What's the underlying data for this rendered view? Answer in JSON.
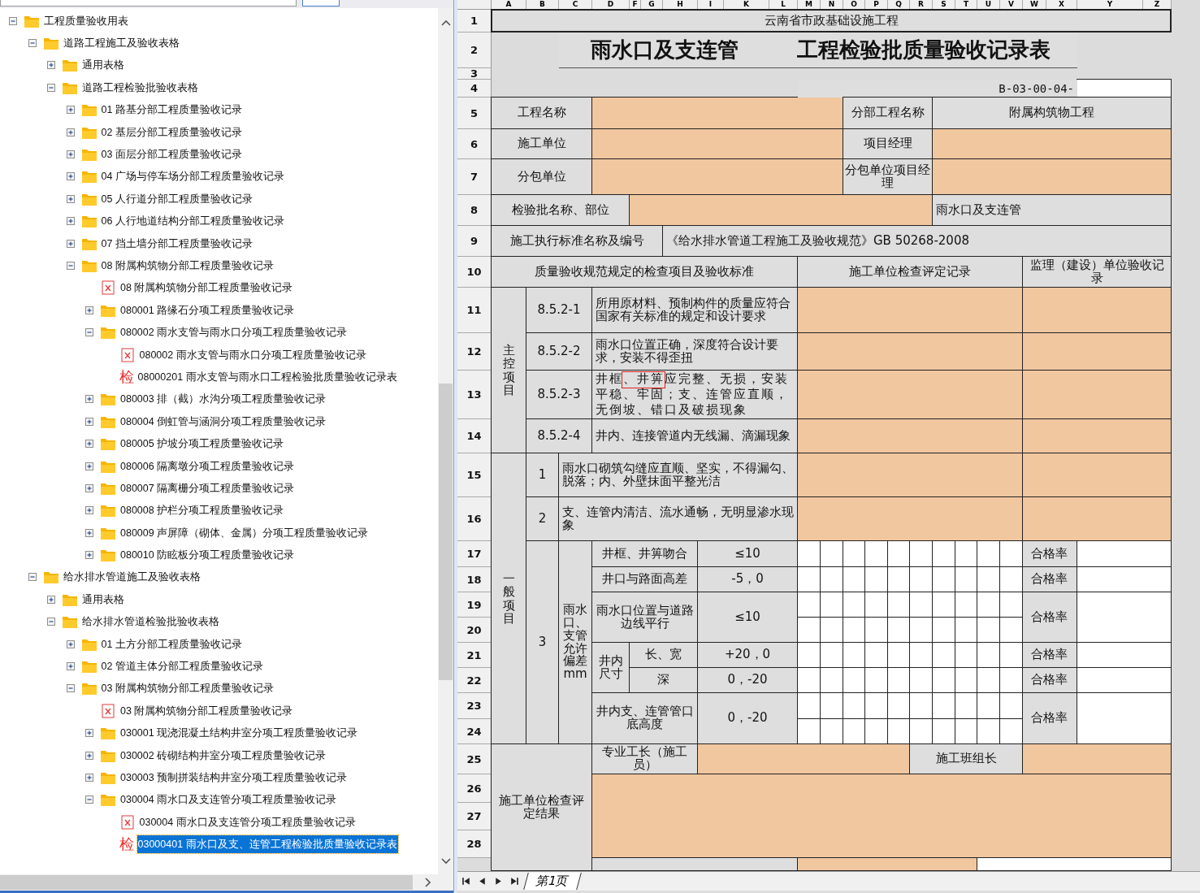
{
  "tree": {
    "items": [
      {
        "kind": "folder",
        "label": "工程质量验收用表",
        "expanded": true,
        "selected": false,
        "children": [
          {
            "kind": "folder",
            "label": "道路工程施工及验收表格",
            "expanded": true,
            "selected": false,
            "children": [
              {
                "kind": "folder",
                "label": "通用表格",
                "expanded": false,
                "selected": false
              },
              {
                "kind": "folder",
                "label": "道路工程检验批验收表格",
                "expanded": true,
                "selected": false,
                "children": [
                  {
                    "kind": "folder",
                    "label": "01 路基分部工程质量验收记录",
                    "expanded": false,
                    "selected": false
                  },
                  {
                    "kind": "folder",
                    "label": "02 基层分部工程质量验收记录",
                    "expanded": false,
                    "selected": false
                  },
                  {
                    "kind": "folder",
                    "label": "03 面层分部工程质量验收记录",
                    "expanded": false,
                    "selected": false
                  },
                  {
                    "kind": "folder",
                    "label": "04 广场与停车场分部工程质量验收记录",
                    "expanded": false,
                    "selected": false
                  },
                  {
                    "kind": "folder",
                    "label": "05 人行道分部工程质量验收记录",
                    "expanded": false,
                    "selected": false
                  },
                  {
                    "kind": "folder",
                    "label": "06 人行地道结构分部工程质量验收记录",
                    "expanded": false,
                    "selected": false
                  },
                  {
                    "kind": "folder",
                    "label": "07 挡土墙分部工程质量验收记录",
                    "expanded": false,
                    "selected": false
                  },
                  {
                    "kind": "folder",
                    "label": "08 附属构筑物分部工程质量验收记录",
                    "expanded": true,
                    "selected": false,
                    "children": [
                      {
                        "kind": "document",
                        "label": "08 附属构筑物分部工程质量验收记录",
                        "selected": false
                      },
                      {
                        "kind": "folder",
                        "label": "080001 路缘石分项工程质量验收记录",
                        "expanded": false,
                        "selected": false
                      },
                      {
                        "kind": "folder",
                        "label": "080002 雨水支管与雨水口分项工程质量验收记录",
                        "expanded": true,
                        "selected": false,
                        "children": [
                          {
                            "kind": "document",
                            "label": "080002 雨水支管与雨水口分项工程质量验收记录",
                            "selected": false
                          },
                          {
                            "kind": "inspection",
                            "icon_char": "检",
                            "label": "08000201 雨水支管与雨水口工程检验批质量验收记录表",
                            "selected": false
                          }
                        ]
                      },
                      {
                        "kind": "folder",
                        "label": "080003 排（截）水沟分项工程质量验收记录",
                        "expanded": false,
                        "selected": false
                      },
                      {
                        "kind": "folder",
                        "label": "080004 倒虹管与涵洞分项工程质量验收记录",
                        "expanded": false,
                        "selected": false
                      },
                      {
                        "kind": "folder",
                        "label": "080005 护坡分项工程质量验收记录",
                        "expanded": false,
                        "selected": false
                      },
                      {
                        "kind": "folder",
                        "label": "080006 隔离墩分项工程质量验收记录",
                        "expanded": false,
                        "selected": false
                      },
                      {
                        "kind": "folder",
                        "label": "080007 隔离栅分项工程质量验收记录",
                        "expanded": false,
                        "selected": false
                      },
                      {
                        "kind": "folder",
                        "label": "080008 护栏分项工程质量验收记录",
                        "expanded": false,
                        "selected": false
                      },
                      {
                        "kind": "folder",
                        "label": "080009 声屏障（砌体、金属）分项工程质量验收记录",
                        "expanded": false,
                        "selected": false
                      },
                      {
                        "kind": "folder",
                        "label": "080010 防眩板分项工程质量验收记录",
                        "expanded": false,
                        "selected": false
                      }
                    ]
                  }
                ]
              }
            ]
          },
          {
            "kind": "folder",
            "label": "给水排水管道施工及验收表格",
            "expanded": true,
            "selected": false,
            "children": [
              {
                "kind": "folder",
                "label": "通用表格",
                "expanded": false,
                "selected": false
              },
              {
                "kind": "folder",
                "label": "给水排水管道检验批验收表格",
                "expanded": true,
                "selected": false,
                "children": [
                  {
                    "kind": "folder",
                    "label": "01 土方分部工程质量验收记录",
                    "expanded": false,
                    "selected": false
                  },
                  {
                    "kind": "folder",
                    "label": "02 管道主体分部工程质量验收记录",
                    "expanded": false,
                    "selected": false
                  },
                  {
                    "kind": "folder",
                    "label": "03 附属构筑物分部工程质量验收记录",
                    "expanded": true,
                    "selected": false,
                    "children": [
                      {
                        "kind": "document",
                        "label": "03 附属构筑物分部工程质量验收记录",
                        "selected": false
                      },
                      {
                        "kind": "folder",
                        "label": "030001 现浇混凝土结构井室分项工程质量验收记录",
                        "expanded": false,
                        "selected": false
                      },
                      {
                        "kind": "folder",
                        "label": "030002 砖砌结构井室分项工程质量验收记录",
                        "expanded": false,
                        "selected": false
                      },
                      {
                        "kind": "folder",
                        "label": "030003 预制拼装结构井室分项工程质量验收记录",
                        "expanded": false,
                        "selected": false
                      },
                      {
                        "kind": "folder",
                        "label": "030004 雨水口及支连管分项工程质量验收记录",
                        "expanded": true,
                        "selected": false,
                        "children": [
                          {
                            "kind": "document",
                            "label": "030004 雨水口及支连管分项工程质量验收记录",
                            "selected": false
                          },
                          {
                            "kind": "inspection",
                            "icon_char": "检",
                            "label": "03000401 雨水口及支、连管工程检验批质量验收记录表",
                            "selected": true
                          }
                        ]
                      }
                    ]
                  }
                ]
              }
            ]
          }
        ]
      }
    ]
  },
  "sheet": {
    "columns": [
      "A",
      "B",
      "C",
      "D",
      "F",
      "G",
      "H",
      "I",
      "K",
      "L",
      "M",
      "N",
      "O",
      "P",
      "Q",
      "R",
      "S",
      "T",
      "U",
      "V",
      "W",
      "X",
      "Y",
      "Z"
    ],
    "row_numbers": [
      "1",
      "2",
      "3",
      "4",
      "5",
      "6",
      "7",
      "8",
      "9",
      "10",
      "11",
      "12",
      "13",
      "14",
      "15",
      "16",
      "17",
      "18",
      "19",
      "20",
      "21",
      "22",
      "23",
      "24",
      "25",
      "26",
      "27",
      "28"
    ],
    "cells": [
      {
        "kind": "banner",
        "text": "云南省市政基础设施工程"
      },
      {
        "kind": "heading",
        "text": "雨水口及支连管"
      },
      {
        "kind": "heading",
        "text": "工程检验批质量验收记录表"
      },
      {
        "kind": "code",
        "text": "B-03-00-04-"
      },
      {
        "kind": "label",
        "text": "工程名称"
      },
      {
        "kind": "label",
        "text": "分部工程名称"
      },
      {
        "kind": "label",
        "text": "附属构筑物工程"
      },
      {
        "kind": "label",
        "text": "施工单位"
      },
      {
        "kind": "label",
        "text": "项目经理"
      },
      {
        "kind": "label",
        "text": "分包单位"
      },
      {
        "kind": "label",
        "text": "分包单位项目经理"
      },
      {
        "kind": "label",
        "text": "检验批名称、部位"
      },
      {
        "kind": "value",
        "text": "雨水口及支连管"
      },
      {
        "kind": "label",
        "text": "施工执行标准名称及编号"
      },
      {
        "kind": "value",
        "text": "《给水排水管道工程施工及验收规范》GB 50268-2008"
      },
      {
        "kind": "label",
        "text": "质量验收规范规定的检查项目及验收标准"
      },
      {
        "kind": "label",
        "text": "施工单位检查评定记录"
      },
      {
        "kind": "label",
        "text": "监理（建设）单位验收记录"
      },
      {
        "kind": "vertical",
        "text": "主控项目"
      },
      {
        "kind": "label",
        "text": "8.5.2-1"
      },
      {
        "kind": "value",
        "text": "所用原材料、预制构件的质量应符合国家有关标准的规定和设计要求"
      },
      {
        "kind": "label",
        "text": "8.5.2-2"
      },
      {
        "kind": "value",
        "text": "雨水口位置正确，深度符合设计要求，安装不得歪扭"
      },
      {
        "kind": "label",
        "text": "8.5.2-3"
      },
      {
        "kind": "value",
        "text": "井框、井箅应完整、无损，安装平稳、牢固；支、连管应直顺，无倒坡、错口及破损现象"
      },
      {
        "kind": "label",
        "text": "8.5.2-4"
      },
      {
        "kind": "value",
        "text": "井内、连接管道内无线漏、滴漏现象"
      },
      {
        "kind": "vertical",
        "text": "一般项目"
      },
      {
        "kind": "label",
        "text": "1"
      },
      {
        "kind": "value",
        "text": "雨水口砌筑勾缝应直顺、坚实，不得漏勾、脱落；内、外壁抹面平整光洁"
      },
      {
        "kind": "label",
        "text": "2"
      },
      {
        "kind": "value",
        "text": "支、连管内清洁、流水通畅，无明显渗水现象"
      },
      {
        "kind": "label",
        "text": "3"
      },
      {
        "kind": "label",
        "text": "雨水口、支管允许偏差mm"
      },
      {
        "kind": "label",
        "text": "井框、井箅吻合"
      },
      {
        "kind": "label",
        "text": "≤10"
      },
      {
        "kind": "rate",
        "text": "合格率"
      },
      {
        "kind": "label",
        "text": "井口与路面高差"
      },
      {
        "kind": "label",
        "text": "-5，0"
      },
      {
        "kind": "rate",
        "text": "合格率"
      },
      {
        "kind": "label",
        "text": "雨水口位置与道路边线平行"
      },
      {
        "kind": "label",
        "text": "≤10"
      },
      {
        "kind": "rate",
        "text": "合格率"
      },
      {
        "kind": "label",
        "text": "井内尺寸"
      },
      {
        "kind": "label",
        "text": "长、宽"
      },
      {
        "kind": "label",
        "text": "+20，0"
      },
      {
        "kind": "rate",
        "text": "合格率"
      },
      {
        "kind": "label",
        "text": "深"
      },
      {
        "kind": "label",
        "text": "0，-20"
      },
      {
        "kind": "rate",
        "text": "合格率"
      },
      {
        "kind": "label",
        "text": "井内支、连管管口底高度"
      },
      {
        "kind": "label",
        "text": "0，-20"
      },
      {
        "kind": "rate",
        "text": "合格率"
      },
      {
        "kind": "label",
        "text": "施工单位检查评定结果"
      },
      {
        "kind": "label",
        "text": "专业工长（施工员）"
      },
      {
        "kind": "label",
        "text": "施工班组长"
      }
    ]
  },
  "sheet_tabs": [
    {
      "label": "第1页",
      "selected": true
    }
  ]
}
